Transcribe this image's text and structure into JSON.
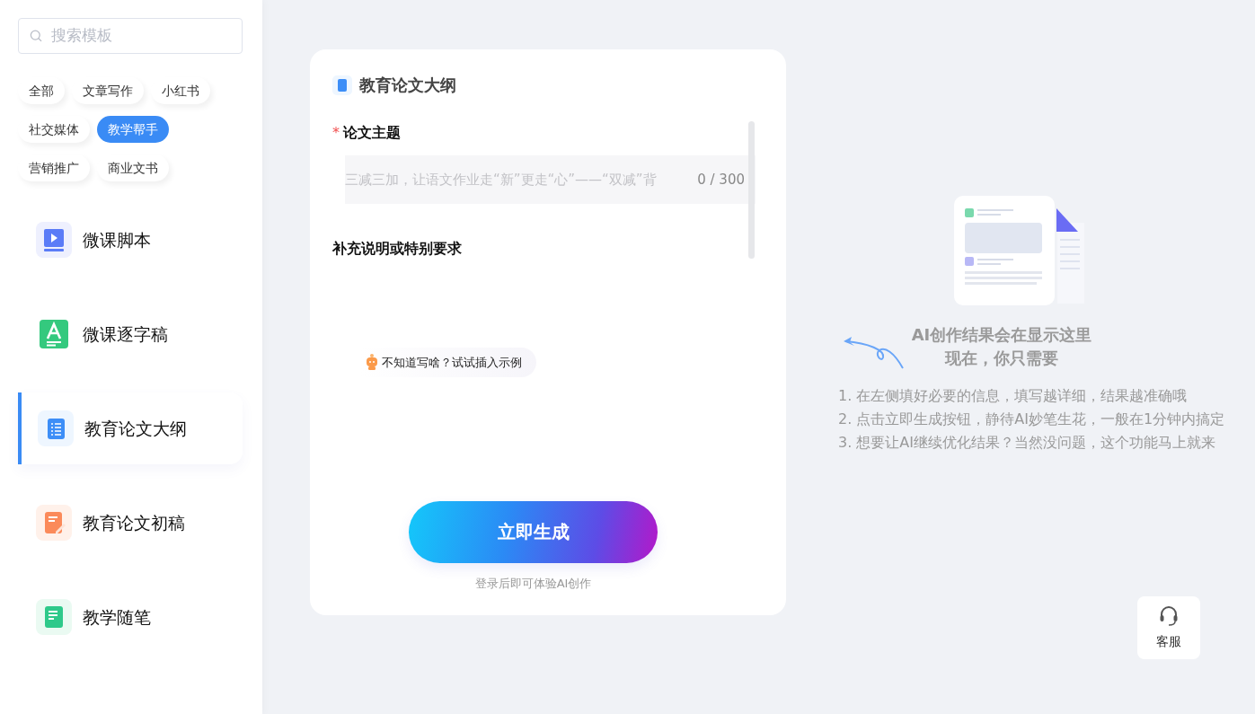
{
  "sidebar": {
    "search": {
      "placeholder": "搜索模板"
    },
    "categories": [
      {
        "label": "全部",
        "selected": false
      },
      {
        "label": "文章写作",
        "selected": false
      },
      {
        "label": "小红书",
        "selected": false
      },
      {
        "label": "社交媒体",
        "selected": false
      },
      {
        "label": "教学帮手",
        "selected": true
      },
      {
        "label": "营销推广",
        "selected": false
      },
      {
        "label": "商业文书",
        "selected": false
      }
    ],
    "templates": [
      {
        "label": "微课脚本",
        "kind": "video",
        "color": "#5b7cf7",
        "selected": false
      },
      {
        "label": "微课逐字稿",
        "kind": "letter",
        "color": "#34c97e",
        "selected": false
      },
      {
        "label": "教育论文大纲",
        "kind": "list",
        "color": "#3d8ef7",
        "selected": true
      },
      {
        "label": "教育论文初稿",
        "kind": "edit",
        "color": "#fb8a5a",
        "selected": false
      },
      {
        "label": "教学随笔",
        "kind": "note",
        "color": "#2ec98a",
        "selected": false
      }
    ]
  },
  "form": {
    "title": "教育论文大纲",
    "fields": [
      {
        "label": "论文主题",
        "required_mark": "*",
        "placeholder": "三减三加，让语文作业走“新”更走“心”——“双减”背",
        "counter": "0 / 300"
      },
      {
        "label": "补充说明或特别要求"
      }
    ],
    "example_hint": "不知道写啥？试试插入示例",
    "generate_button": "立即生成",
    "login_note": "登录后即可体验AI创作"
  },
  "result": {
    "heading": [
      "AI创作结果会在显示这里",
      "现在，你只需要"
    ],
    "steps": [
      "1. 在左侧填好必要的信息，填写越详细，结果越准确哦",
      "2. 点击立即生成按钮，静待AI妙笔生花，一般在1分钟内搞定",
      "3. 想要让AI继续优化结果？当然没问题，这个功能马上就来"
    ]
  },
  "support_button": "客服"
}
